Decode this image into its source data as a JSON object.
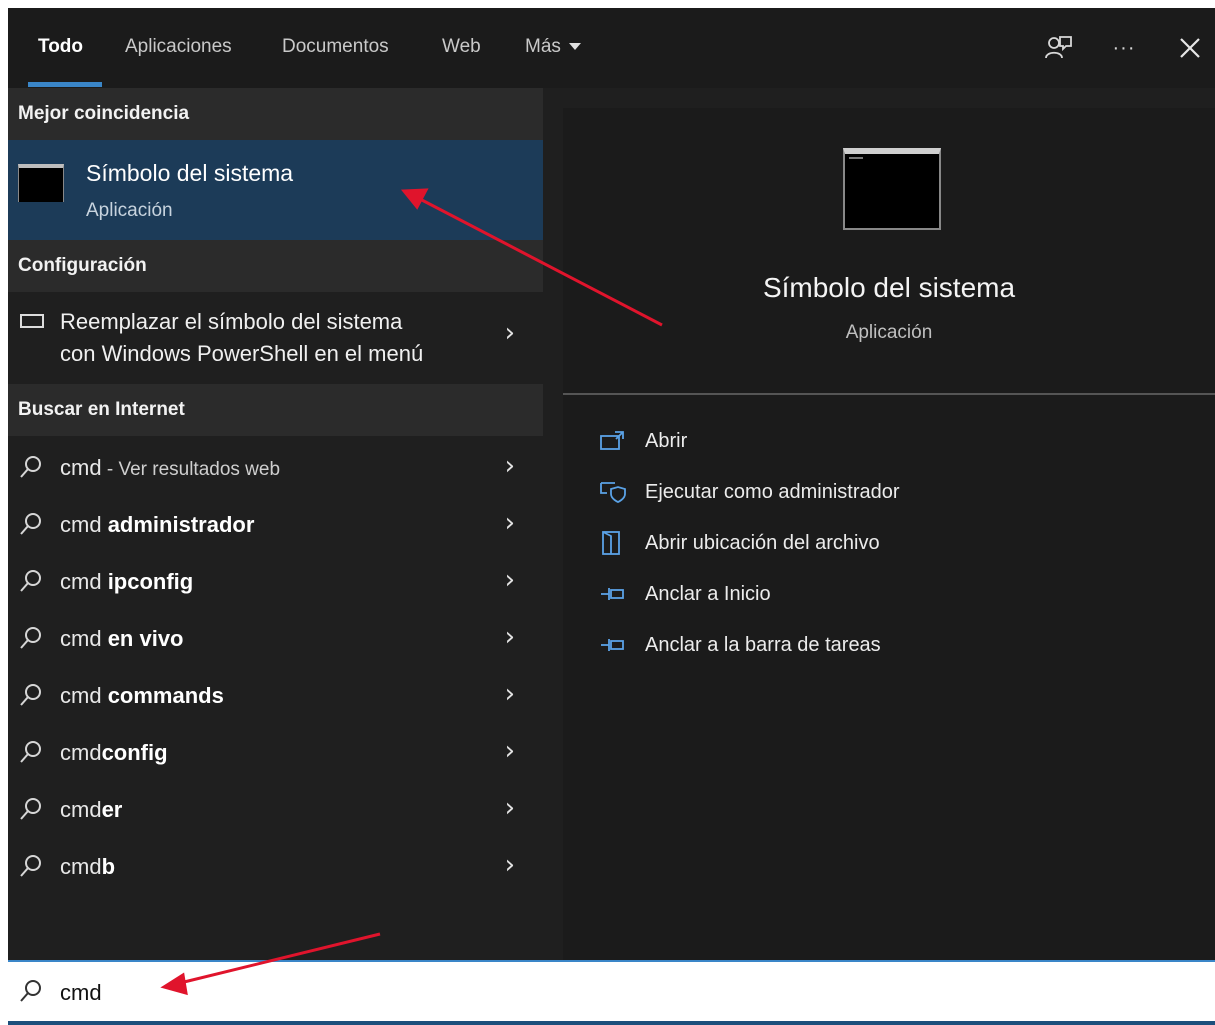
{
  "tabs": [
    {
      "label": "Todo",
      "active": true
    },
    {
      "label": "Aplicaciones",
      "active": false
    },
    {
      "label": "Documentos",
      "active": false
    },
    {
      "label": "Web",
      "active": false
    },
    {
      "label": "Más",
      "active": false
    }
  ],
  "header_icons": [
    "feedback-icon",
    "more-options-icon",
    "close-icon"
  ],
  "more_label": "···",
  "left": {
    "best_match_header": "Mejor coincidencia",
    "best_match": {
      "title": "Símbolo del sistema",
      "subtitle": "Aplicación"
    },
    "config_header": "Configuración",
    "config_item": {
      "line1": "Reemplazar el símbolo del sistema",
      "line2": "con Windows PowerShell en el menú"
    },
    "web_header": "Buscar en Internet",
    "web_results": [
      {
        "prefix": "cmd",
        "bold": "",
        "hint": " - Ver resultados web"
      },
      {
        "prefix": "cmd ",
        "bold": "administrador",
        "hint": ""
      },
      {
        "prefix": "cmd ",
        "bold": "ipconfig",
        "hint": ""
      },
      {
        "prefix": "cmd ",
        "bold": "en vivo",
        "hint": ""
      },
      {
        "prefix": "cmd ",
        "bold": "commands",
        "hint": ""
      },
      {
        "prefix": "cmd",
        "bold": "config",
        "hint": ""
      },
      {
        "prefix": "cmd",
        "bold": "er",
        "hint": ""
      },
      {
        "prefix": "cmd",
        "bold": "b",
        "hint": ""
      }
    ]
  },
  "right": {
    "title": "Símbolo del sistema",
    "subtitle": "Aplicación",
    "actions": [
      {
        "label": "Abrir",
        "icon": "open-icon"
      },
      {
        "label": "Ejecutar como administrador",
        "icon": "run-as-admin-icon"
      },
      {
        "label": "Abrir ubicación del archivo",
        "icon": "file-location-icon"
      },
      {
        "label": "Anclar a Inicio",
        "icon": "pin-icon"
      },
      {
        "label": "Anclar a la barra de tareas",
        "icon": "pin-icon"
      }
    ]
  },
  "search": {
    "value": "cmd",
    "placeholder": ""
  },
  "colors": {
    "selected_bg": "#1c3b58",
    "accent": "#3a86c8",
    "annotation_arrow": "#e0142c"
  }
}
